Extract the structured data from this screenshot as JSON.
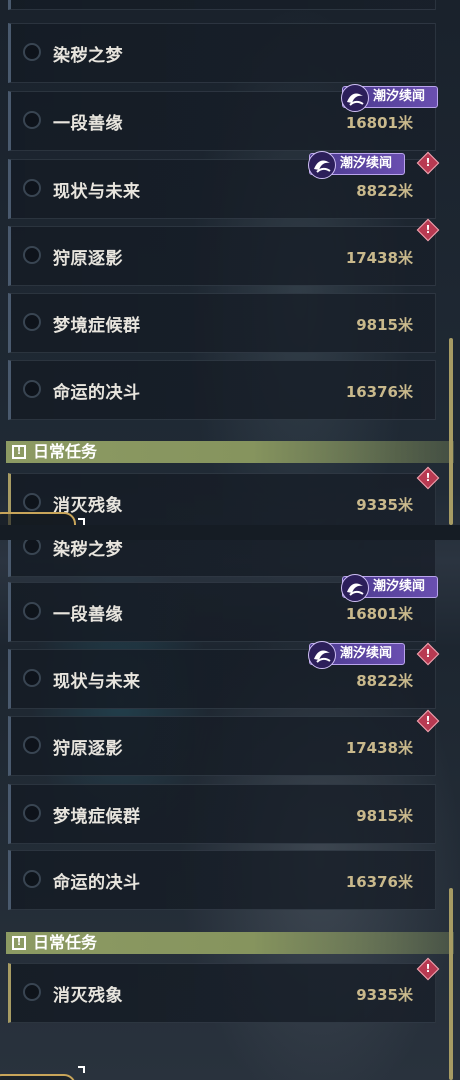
{
  "tag_label": "潮汐续闻",
  "warn_symbol": "!",
  "section_daily": {
    "label": "日常任务",
    "icon": "!"
  },
  "quests": [
    {
      "name": "染秽之梦",
      "distance": ""
    },
    {
      "name": "一段善缘",
      "distance": "16801米"
    },
    {
      "name": "现状与未来",
      "distance": "8822米"
    },
    {
      "name": "狩原逐影",
      "distance": "17438米"
    },
    {
      "name": "梦境症候群",
      "distance": "9815米"
    },
    {
      "name": "命运的决斗",
      "distance": "16376米"
    },
    {
      "name": "消灭残象",
      "distance": "9335米"
    }
  ],
  "colors": {
    "distance_text": "#c9b98c",
    "tag_purple": "#6a4fb0",
    "warning_red": "#b83a52",
    "daily_header_green": "#8c9a63",
    "scrollbar": "#a79c64"
  },
  "icons": {
    "tag": "tide-wave-icon",
    "warning": "exclamation-diamond-icon",
    "daily": "exclamation-square-icon",
    "quest_state": "radio-circle-icon"
  }
}
